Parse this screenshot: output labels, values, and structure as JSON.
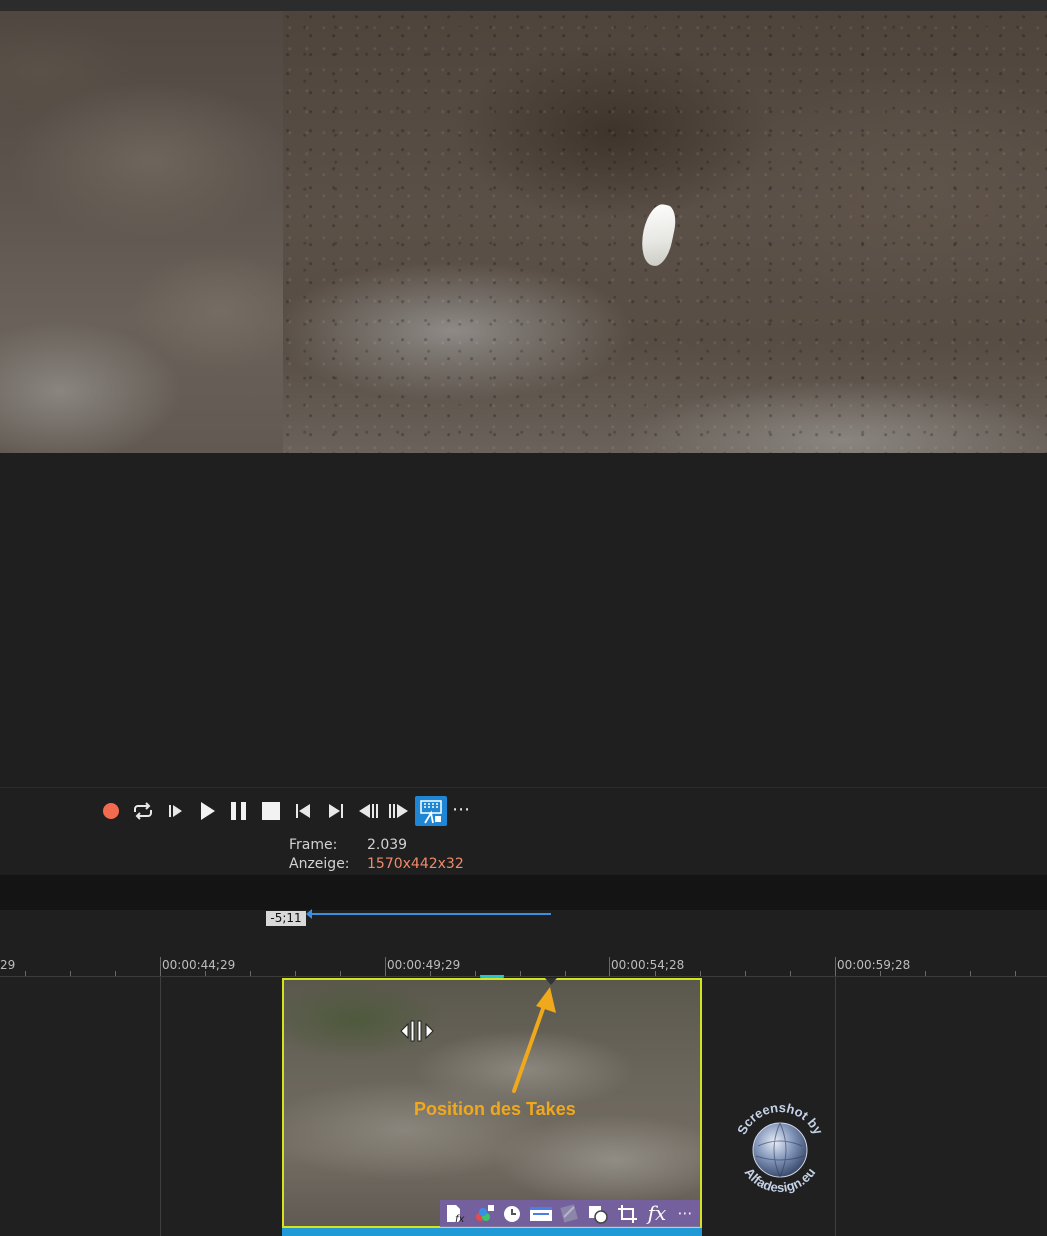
{
  "transport": {
    "record_icon": "record-icon",
    "loop_icon": "loop-icon",
    "play_start_icon": "play-from-start-icon",
    "play_icon": "play-icon",
    "pause_icon": "pause-icon",
    "stop_icon": "stop-icon",
    "go_start_icon": "go-to-start-icon",
    "go_end_icon": "go-to-end-icon",
    "prev_frame_icon": "previous-frame-icon",
    "next_frame_icon": "next-frame-icon",
    "sync_icon": "sync-cursor-icon",
    "more_label": "⋯",
    "accent_color": "#1f86d6",
    "record_color": "#f36b4f"
  },
  "info": {
    "frame_label": "Frame:",
    "frame_value": "2.039",
    "display_label": "Anzeige:",
    "display_value": "1570x442x32"
  },
  "region": {
    "offset": "-5;11"
  },
  "ruler": {
    "labels": [
      "29",
      "00:00:44;29",
      "00:00:49;29",
      "00:00:54;28",
      "00:00:59;28"
    ]
  },
  "clip": {
    "border_color": "#d4e41c",
    "fx_icons": [
      "fx-media-icon",
      "color-icon",
      "clock-icon",
      "pan-crop-window-icon",
      "event-effect-icon",
      "media-generator-icon",
      "crop-icon",
      "fx-icon",
      "more-icon"
    ],
    "fx_label": "fx",
    "fx_more": "⋯"
  },
  "annotation": {
    "text": "Position des Takes",
    "color": "#f0a81c"
  },
  "watermark": {
    "text_top": "Screenshot by",
    "text_bottom": "Alfadesign.eu"
  }
}
